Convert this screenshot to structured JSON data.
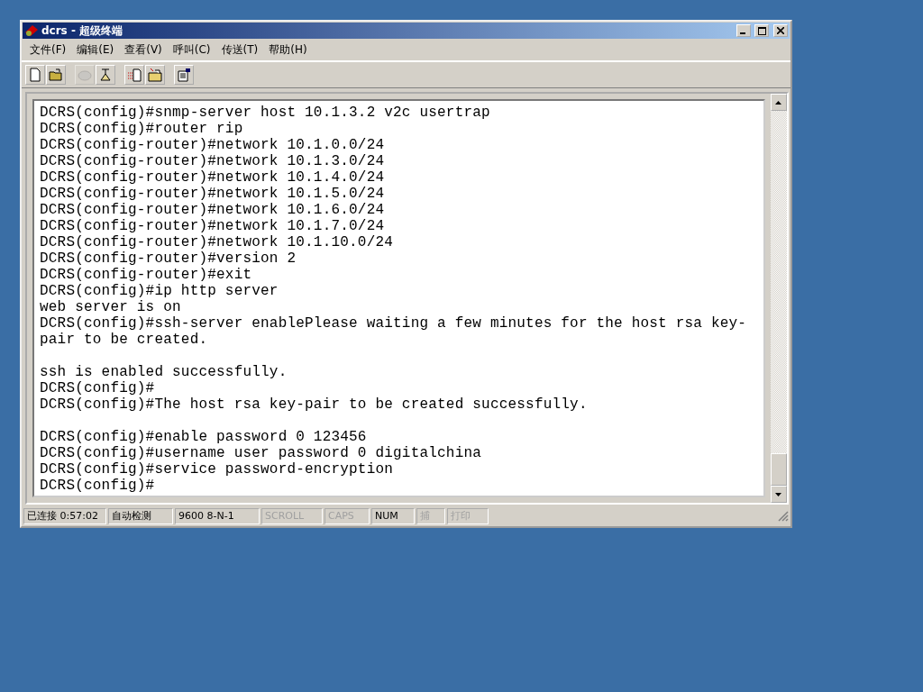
{
  "window": {
    "title": "dcrs - 超级终端"
  },
  "menu": [
    {
      "label": "文件(F)"
    },
    {
      "label": "编辑(E)"
    },
    {
      "label": "查看(V)"
    },
    {
      "label": "呼叫(C)"
    },
    {
      "label": "传送(T)"
    },
    {
      "label": "帮助(H)"
    }
  ],
  "toolbar": [
    {
      "kind": "new",
      "disabled": false
    },
    {
      "kind": "open",
      "disabled": false
    },
    {
      "kind": "separator"
    },
    {
      "kind": "dial",
      "disabled": true
    },
    {
      "kind": "hangup",
      "disabled": false
    },
    {
      "kind": "separator"
    },
    {
      "kind": "send",
      "disabled": false
    },
    {
      "kind": "receive",
      "disabled": false
    },
    {
      "kind": "separator"
    },
    {
      "kind": "properties",
      "disabled": false
    }
  ],
  "terminal": {
    "lines": [
      {
        "kind": "text",
        "text": "DCRS(config)#snmp-server host 10.1.3.2 v2c usertrap"
      },
      {
        "kind": "text",
        "text": "DCRS(config)#router rip"
      },
      {
        "kind": "text",
        "text": "DCRS(config-router)#network 10.1.0.0/24"
      },
      {
        "kind": "text",
        "text": "DCRS(config-router)#network 10.1.3.0/24"
      },
      {
        "kind": "text",
        "text": "DCRS(config-router)#network 10.1.4.0/24"
      },
      {
        "kind": "text",
        "text": "DCRS(config-router)#network 10.1.5.0/24"
      },
      {
        "kind": "text",
        "text": "DCRS(config-router)#network 10.1.6.0/24"
      },
      {
        "kind": "text",
        "text": "DCRS(config-router)#network 10.1.7.0/24"
      },
      {
        "kind": "text",
        "text": "DCRS(config-router)#network 10.1.10.0/24"
      },
      {
        "kind": "text",
        "text": "DCRS(config-router)#version 2"
      },
      {
        "kind": "text",
        "text": "DCRS(config-router)#exit"
      },
      {
        "kind": "text",
        "text": "DCRS(config)#ip http server"
      },
      {
        "kind": "text",
        "text": "web server is on"
      },
      {
        "kind": "text",
        "text": "DCRS(config)#ssh-server enablePlease waiting a few minutes for the host rsa key-"
      },
      {
        "kind": "text",
        "text": "pair to be created."
      },
      {
        "kind": "blank"
      },
      {
        "kind": "text",
        "text": "ssh is enabled successfully."
      },
      {
        "kind": "text",
        "text": "DCRS(config)#"
      },
      {
        "kind": "text",
        "text": "DCRS(config)#The host rsa key-pair to be created successfully."
      },
      {
        "kind": "blank"
      },
      {
        "kind": "text",
        "text": "DCRS(config)#enable password 0 123456"
      },
      {
        "kind": "text",
        "text": "DCRS(config)#username user password 0 digitalchina"
      },
      {
        "kind": "text",
        "text": "DCRS(config)#service password-encryption"
      },
      {
        "kind": "text",
        "text": "DCRS(config)#"
      }
    ]
  },
  "status_bar": [
    {
      "text": "已连接 0:57:02",
      "disabled": false
    },
    {
      "text": "自动检测",
      "disabled": false
    },
    {
      "text": "9600 8-N-1",
      "disabled": false
    },
    {
      "text": "SCROLL",
      "disabled": true
    },
    {
      "text": "CAPS",
      "disabled": true
    },
    {
      "text": "NUM",
      "disabled": false
    },
    {
      "text": "捕",
      "disabled": true
    },
    {
      "text": "打印",
      "disabled": true
    }
  ]
}
